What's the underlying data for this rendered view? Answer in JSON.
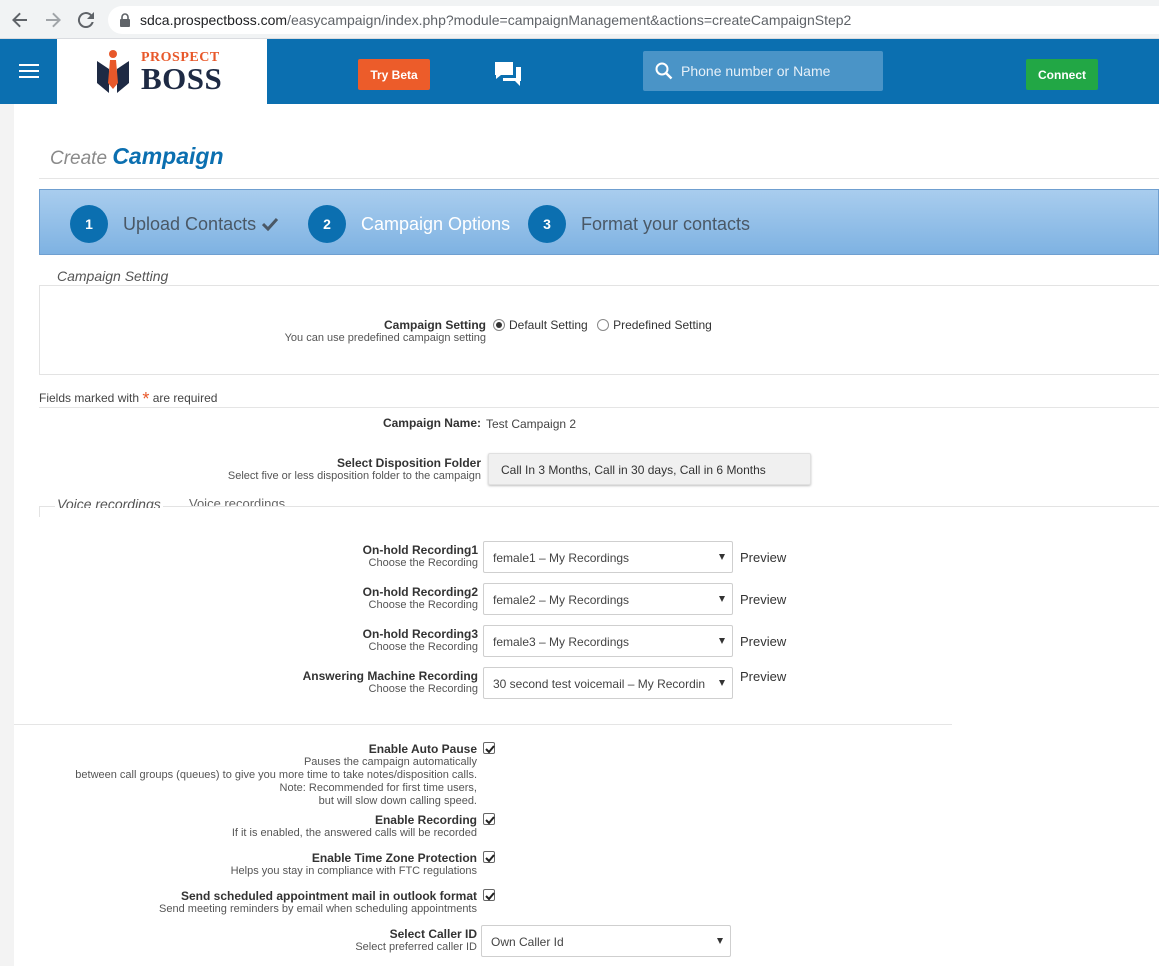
{
  "browser": {
    "url_host": "sdca.prospectboss.com",
    "url_path": "/easycampaign/index.php?module=campaignManagement&actions=createCampaignStep2"
  },
  "header": {
    "logo_top": "PROSPECT",
    "logo_bottom": "BOSS",
    "try_beta_label": "Try Beta",
    "search_placeholder": "Phone number or Name",
    "connect_label": "Connect"
  },
  "page": {
    "title_prefix": "Create",
    "title_main": "Campaign"
  },
  "wizard": {
    "steps": [
      {
        "num": "1",
        "label": "Upload Contacts"
      },
      {
        "num": "2",
        "label": "Campaign Options"
      },
      {
        "num": "3",
        "label": "Format your contacts"
      }
    ]
  },
  "campaign_setting": {
    "legend": "Campaign Setting",
    "label": "Campaign Setting",
    "sublabel": "You can use predefined campaign setting",
    "option_default": "Default Setting",
    "option_predefined": "Predefined Setting"
  },
  "required_note": {
    "before": "Fields marked with",
    "star": "*",
    "after": "are required"
  },
  "campaign_name": {
    "label": "Campaign Name:",
    "value": "Test Campaign 2"
  },
  "disposition": {
    "label": "Select Disposition Folder",
    "sublabel": "Select five or less disposition folder to the campaign",
    "value": "Call In 3 Months, Call in 30 days, Call in 6 Months"
  },
  "voice": {
    "legend": "Voice recordings",
    "legend_ghost": "Voice recordings",
    "rows": [
      {
        "label": "On-hold Recording1",
        "sublabel": "Choose the Recording",
        "value": "female1 – My Recordings",
        "preview": "Preview"
      },
      {
        "label": "On-hold Recording2",
        "sublabel": "Choose the Recording",
        "value": "female2 – My Recordings",
        "preview": "Preview"
      },
      {
        "label": "On-hold Recording3",
        "sublabel": "Choose the Recording",
        "value": "female3 – My Recordings",
        "preview": "Preview"
      },
      {
        "label": "Answering Machine Recording",
        "sublabel": "Choose the Recording",
        "value": "30 second test voicemail – My Recordin",
        "preview": "Preview"
      }
    ]
  },
  "options": {
    "auto_pause": {
      "label": "Enable Auto Pause",
      "lines": [
        "Pauses the campaign automatically",
        "between call groups (queues) to give you more time to take notes/disposition calls.",
        "Note: Recommended for first time users,",
        "but will slow down calling speed."
      ]
    },
    "recording": {
      "label": "Enable Recording",
      "sublabel": "If it is enabled, the answered calls will be recorded"
    },
    "timezone": {
      "label": "Enable Time Zone Protection",
      "sublabel": "Helps you stay in compliance with FTC regulations"
    },
    "outlook": {
      "label": "Send scheduled appointment mail in outlook format",
      "sublabel": "Send meeting reminders by email when scheduling appointments"
    },
    "caller_id": {
      "label": "Select Caller ID",
      "sublabel": "Select preferred caller ID",
      "value": "Own Caller Id"
    }
  },
  "colors": {
    "brand_blue": "#0b6fb0",
    "beta_orange": "#ec5c2a",
    "connect_green": "#22a745",
    "required_star": "#e8582a"
  }
}
